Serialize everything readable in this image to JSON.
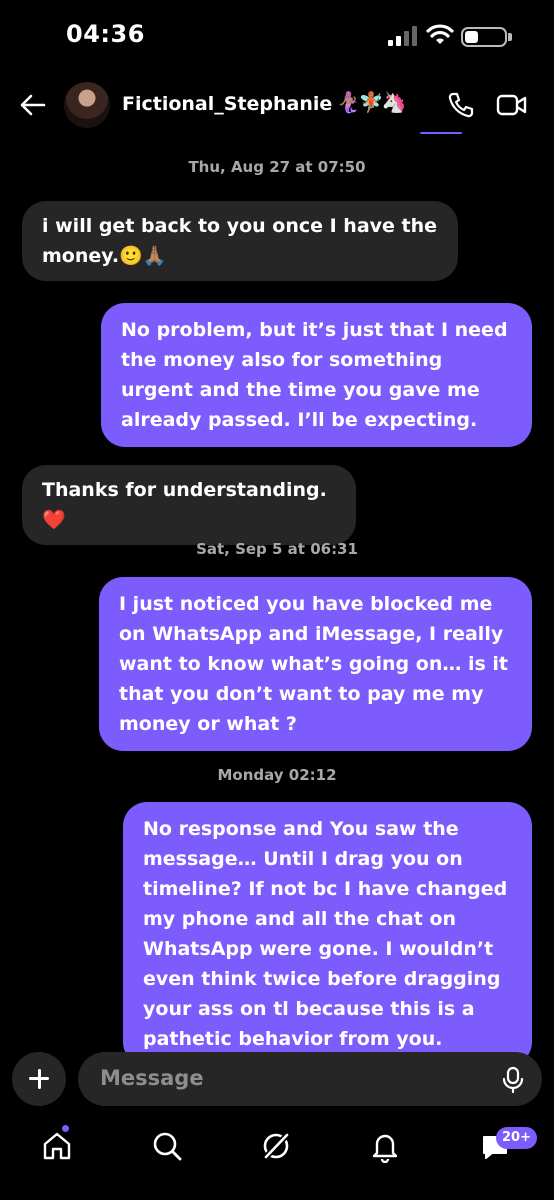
{
  "status": {
    "time": "04:36"
  },
  "header": {
    "username": "Fictional_Stephanie",
    "emojis": "🧜🏽‍♀️🧚🏽🦄"
  },
  "messages": [
    {
      "type": "timestamp",
      "text": "Thu, Aug 27 at 07:50"
    },
    {
      "type": "in",
      "text": "i will get back to you once I have the money.🙂🙏🏽"
    },
    {
      "type": "out",
      "text": "No problem, but it’s just that I need the money also for something urgent and the time you gave me already passed. I’ll be expecting."
    },
    {
      "type": "in",
      "text": "Thanks for understanding.❤️"
    },
    {
      "type": "timestamp",
      "text": "Sat, Sep 5 at 06:31"
    },
    {
      "type": "out",
      "text": "I just noticed you have blocked me on WhatsApp and iMessage, I really want to know what’s going on… is it that you don’t want to pay me my money or what ?"
    },
    {
      "type": "timestamp",
      "text": "Monday 02:12"
    },
    {
      "type": "out",
      "text": "No response and You saw the message… Until I drag you on timeline? If not bc I have changed my phone and all the chat on WhatsApp were gone. I wouldn’t even think twice before dragging your ass on tl because this is a pathetic behavior from you."
    }
  ],
  "composer": {
    "placeholder": "Message"
  },
  "nav": {
    "badge": "20+"
  },
  "colors": {
    "accent": "#7c5cfc",
    "incoming_bubble": "#262626",
    "background": "#000000"
  }
}
